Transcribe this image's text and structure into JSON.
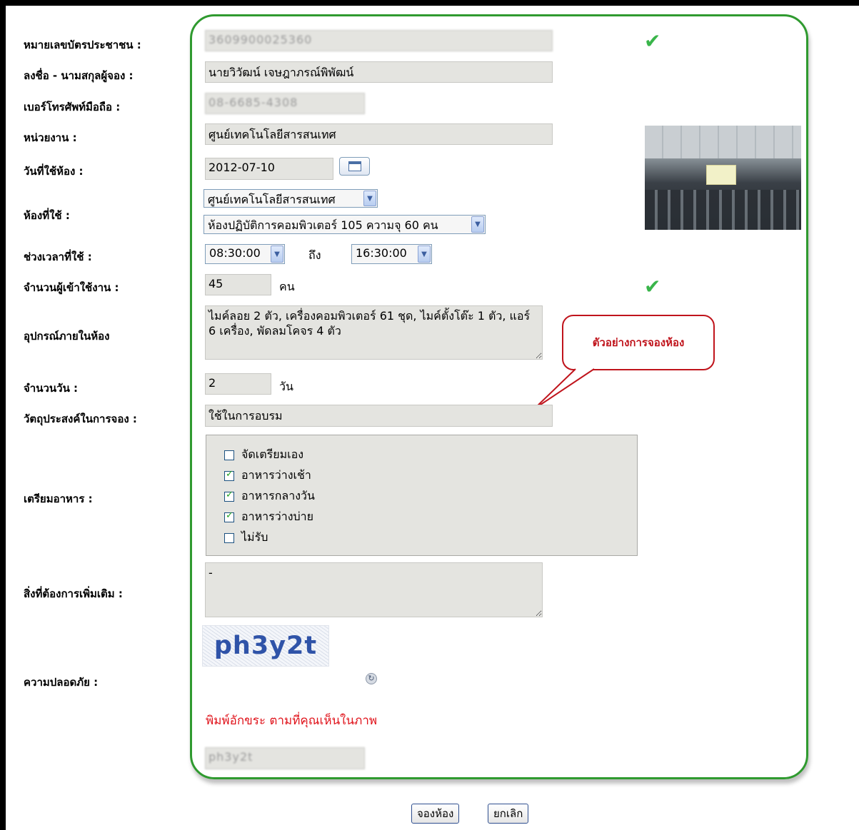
{
  "labels": {
    "id_card": "หมายเลขบัตรประชาชน :",
    "name": "ลงชื่อ - นามสกุลผู้จอง :",
    "phone": "เบอร์โทรศัพท์มือถือ :",
    "department": "หน่วยงาน :",
    "date": "วันที่ใช้ห้อง :",
    "room": "ห้องที่ใช้ :",
    "time": "ช่วงเวลาที่ใช้ :",
    "attendees": "จำนวนผู้เข้าใช้งาน :",
    "equipment": "อุปกรณ์ภายในห้อง",
    "days": "จำนวนวัน :",
    "purpose": "วัตถุประสงค์ในการจอง :",
    "food": "เตรียมอาหาร :",
    "extra": "สิ่งที่ต้องการเพิ่มเติม :",
    "security": "ความปลอดภัย :"
  },
  "fields": {
    "id_card": "3609900025360",
    "name": "นายวิวัฒน์ เจษฎาภรณ์พิพัฒน์",
    "phone": "08-6685-4308",
    "department": "ศูนย์เทคโนโลยีสารสนเทศ",
    "date": "2012-07-10",
    "room_building": "ศูนย์เทคโนโลยีสารสนเทศ",
    "room_name": "ห้องปฏิบัติการคอมพิวเตอร์ 105 ความจุ 60 คน",
    "time_from": "08:30:00",
    "time_to_word": "ถึง",
    "time_to": "16:30:00",
    "attendees": "45",
    "attendees_unit": "คน",
    "equipment": "ไมค์ลอย 2 ตัว, เครื่องคอมพิวเตอร์ 61 ชุด, ไมค์ตั้งโต๊ะ 1 ตัว, แอร์ 6 เครื่อง, พัดลมโคจร 4 ตัว",
    "days": "2",
    "days_unit": "วัน",
    "purpose": "ใช้ในการอบรม",
    "extra": "-",
    "captcha_input": "ph3y2t"
  },
  "food_options": [
    {
      "label": "จัดเตรียมเอง",
      "checked": false
    },
    {
      "label": "อาหารว่างเช้า",
      "checked": true
    },
    {
      "label": "อาหารกลางวัน",
      "checked": true
    },
    {
      "label": "อาหารว่างบ่าย",
      "checked": true
    },
    {
      "label": "ไม่รับ",
      "checked": false
    }
  ],
  "callout": "ตัวอย่างการจองห้อง",
  "captcha": {
    "text": "ph3y2t",
    "hint": "พิมพ์อักขระ ตามที่คุณเห็นในภาพ"
  },
  "buttons": {
    "submit": "จองห้อง",
    "cancel": "ยกเลิก"
  },
  "icons": {
    "valid": "check-icon",
    "calendar": "calendar-icon",
    "refresh": "refresh-icon",
    "dropdown": "chevron-down-icon"
  },
  "colors": {
    "frame_border": "#2f9a2f",
    "callout": "#c0141c",
    "hint": "#e0141c",
    "field_bg": "#e4e4e0"
  }
}
